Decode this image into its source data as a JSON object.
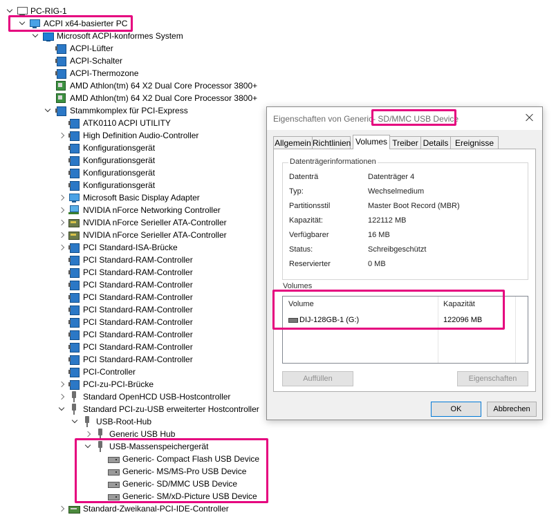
{
  "tree": {
    "root": "PC-RIG-1",
    "computer": "ACPI x64-basierter PC",
    "system": "Microsoft ACPI-konformes System",
    "acpi_items": [
      "ACPI-Lüfter",
      "ACPI-Schalter",
      "ACPI-Thermozone"
    ],
    "cpus": [
      "AMD Athlon(tm) 64 X2 Dual Core Processor 3800+",
      "AMD Athlon(tm) 64 X2 Dual Core Processor 3800+"
    ],
    "pci_root": "Stammkomplex für PCI-Express",
    "pci_children": [
      "ATK0110 ACPI UTILITY",
      "High Definition Audio-Controller",
      "Konfigurationsgerät",
      "Konfigurationsgerät",
      "Konfigurationsgerät",
      "Konfigurationsgerät",
      "Microsoft Basic Display Adapter",
      "NVIDIA nForce Networking Controller",
      "NVIDIA nForce Serieller ATA-Controller",
      "NVIDIA nForce Serieller ATA-Controller",
      "PCI Standard-ISA-Brücke",
      "PCI Standard-RAM-Controller",
      "PCI Standard-RAM-Controller",
      "PCI Standard-RAM-Controller",
      "PCI Standard-RAM-Controller",
      "PCI Standard-RAM-Controller",
      "PCI Standard-RAM-Controller",
      "PCI Standard-RAM-Controller",
      "PCI Standard-RAM-Controller",
      "PCI Standard-RAM-Controller",
      "PCI-Controller",
      "PCI-zu-PCI-Brücke",
      "Standard OpenHCD USB-Hostcontroller",
      "Standard PCI-zu-USB erweiterter Hostcontroller"
    ],
    "usb_root_hub": "USB-Root-Hub",
    "generic_usb_hub": "Generic USB Hub",
    "mass_storage": "USB-Massenspeichergerät",
    "storage_devices": [
      "Generic- Compact Flash USB Device",
      "Generic- MS/MS-Pro USB Device",
      "Generic- SD/MMC USB Device",
      "Generic- SM/xD-Picture USB Device"
    ],
    "ide_controller": "Standard-Zweikanal-PCI-IDE-Controller"
  },
  "dialog": {
    "title": "Eigenschaften von Generic- SD/MMC USB Device",
    "tabs": [
      "Allgemein",
      "Richtlinien",
      "Volumes",
      "Treiber",
      "Details",
      "Ereignisse"
    ],
    "active_tab": "Volumes",
    "group_title": "Datenträgerinformationen",
    "properties": [
      {
        "key": "Datenträ",
        "value": "Datenträger 4"
      },
      {
        "key": "Typ:",
        "value": "Wechselmedium"
      },
      {
        "key": "Partitionsstil",
        "value": "Master Boot Record (MBR)"
      },
      {
        "key": "Kapazität:",
        "value": "122112 MB"
      },
      {
        "key": "Verfügbarer",
        "value": "16 MB"
      },
      {
        "key": "Status:",
        "value": "Schreibgeschützt"
      },
      {
        "key": "Reservierter",
        "value": "0 MB"
      }
    ],
    "volumes_label": "Volumes",
    "volumes_headers": {
      "volume": "Volume",
      "capacity": "Kapazität"
    },
    "volumes": [
      {
        "name": "DIJ-128GB-1 (G:)",
        "capacity": "122096 MB"
      }
    ],
    "buttons": {
      "populate": "Auffüllen",
      "properties": "Eigenschaften",
      "ok": "OK",
      "cancel": "Abbrechen"
    }
  },
  "colors": {
    "highlight": "#e5007e",
    "accent": "#0078d7"
  }
}
